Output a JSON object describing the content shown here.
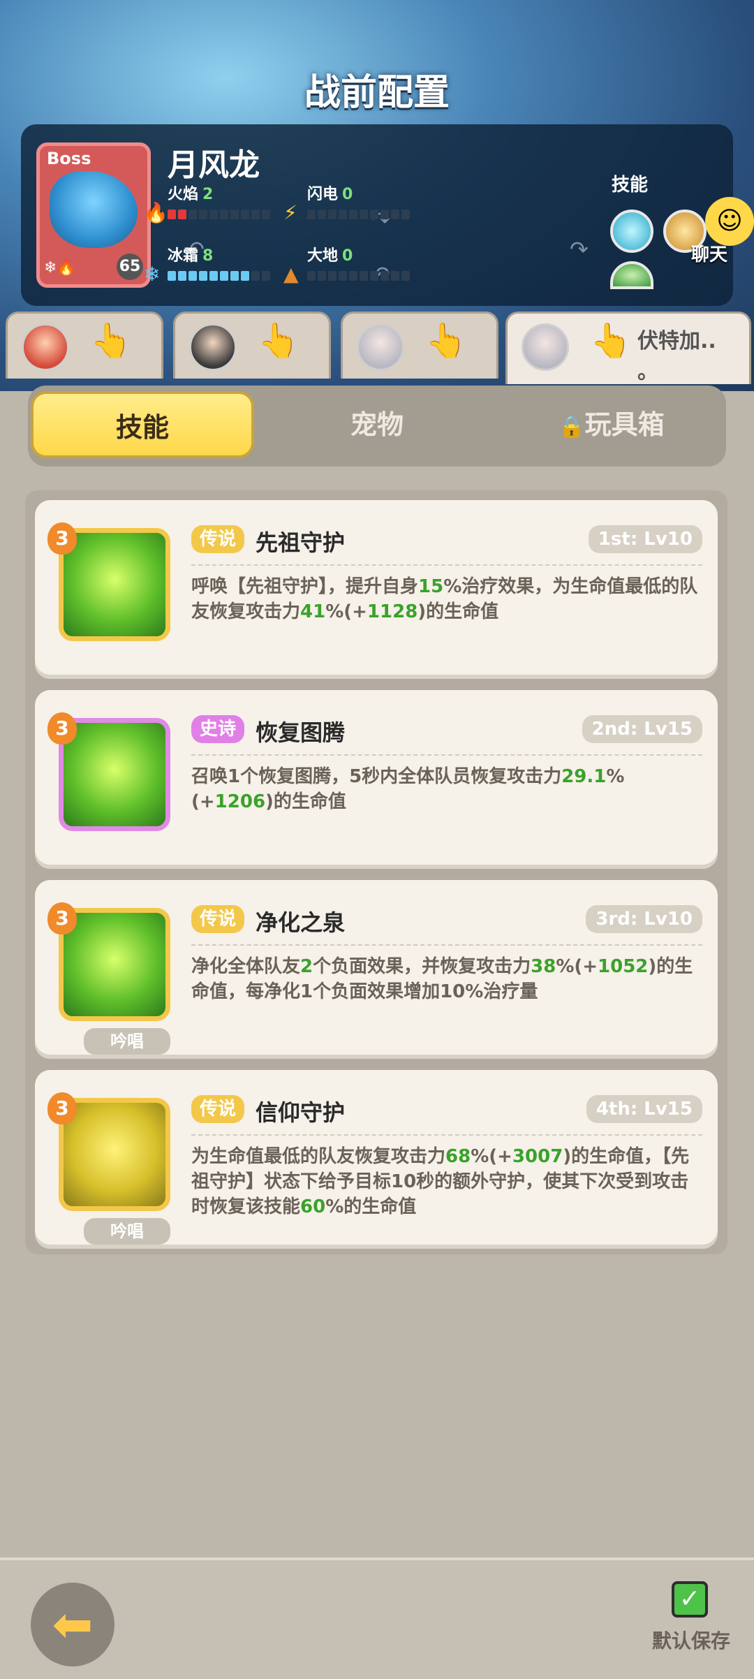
{
  "header": {
    "title": "战前配置"
  },
  "boss": {
    "tag": "Boss",
    "name": "月风龙",
    "level": "65",
    "stats": [
      {
        "label": "火焰",
        "value": "2",
        "fill": 2,
        "color": "red"
      },
      {
        "label": "闪电",
        "value": "0",
        "fill": 0,
        "color": "red"
      },
      {
        "label": "冰霜",
        "value": "8",
        "fill": 8,
        "color": "blue"
      },
      {
        "label": "大地",
        "value": "0",
        "fill": 0,
        "color": "red"
      }
    ],
    "skills_label": "技能"
  },
  "chat": {
    "label": "聊天"
  },
  "team": {
    "slots": [
      {
        "name": ""
      },
      {
        "name": ""
      },
      {
        "name": ""
      },
      {
        "name": "伏特加..\n。"
      }
    ]
  },
  "tabs": [
    {
      "label": "技能",
      "active": true
    },
    {
      "label": "宠物",
      "active": false
    },
    {
      "label": "玩具箱",
      "active": false,
      "locked": true
    }
  ],
  "skills": [
    {
      "badge": "3",
      "rarity": "传说",
      "name": "先祖守护",
      "slot_level": "1st: Lv10",
      "desc_parts": [
        "呼唤【先祖守护】，提升自身",
        "15",
        "%治疗效果，为生命值最低的队友恢复攻击力",
        "41",
        "%(+",
        "1128",
        ")的生命值"
      ],
      "chant": ""
    },
    {
      "badge": "3",
      "rarity": "史诗",
      "name": "恢复图腾",
      "slot_level": "2nd: Lv15",
      "desc_parts": [
        "召唤1个恢复图腾，5秒内全体队员恢复攻击力",
        "29.1",
        "%(+",
        "1206",
        ")的生命值"
      ],
      "chant": ""
    },
    {
      "badge": "3",
      "rarity": "传说",
      "name": "净化之泉",
      "slot_level": "3rd: Lv10",
      "desc_parts": [
        "净化全体队友",
        "2",
        "个负面效果，并恢复攻击力",
        "38",
        "%(+",
        "1052",
        ")的生命值，每净化1个负面效果增加10%治疗量"
      ],
      "chant": "吟唱"
    },
    {
      "badge": "3",
      "rarity": "传说",
      "name": "信仰守护",
      "slot_level": "4th: Lv15",
      "desc_parts": [
        "为生命值最低的队友恢复攻击力",
        "68",
        "%(+",
        "3007",
        ")的生命值，【先祖守护】状态下给予目标10秒的额外守护，使其下次受到攻击时恢复该技能",
        "60",
        "%的生命值"
      ],
      "chant": "吟唱"
    }
  ],
  "footer": {
    "save_label": "默认保存"
  },
  "colors": {
    "accent": "#ffd84a",
    "green_value": "#3aa22a",
    "panel": "#0e2238"
  }
}
